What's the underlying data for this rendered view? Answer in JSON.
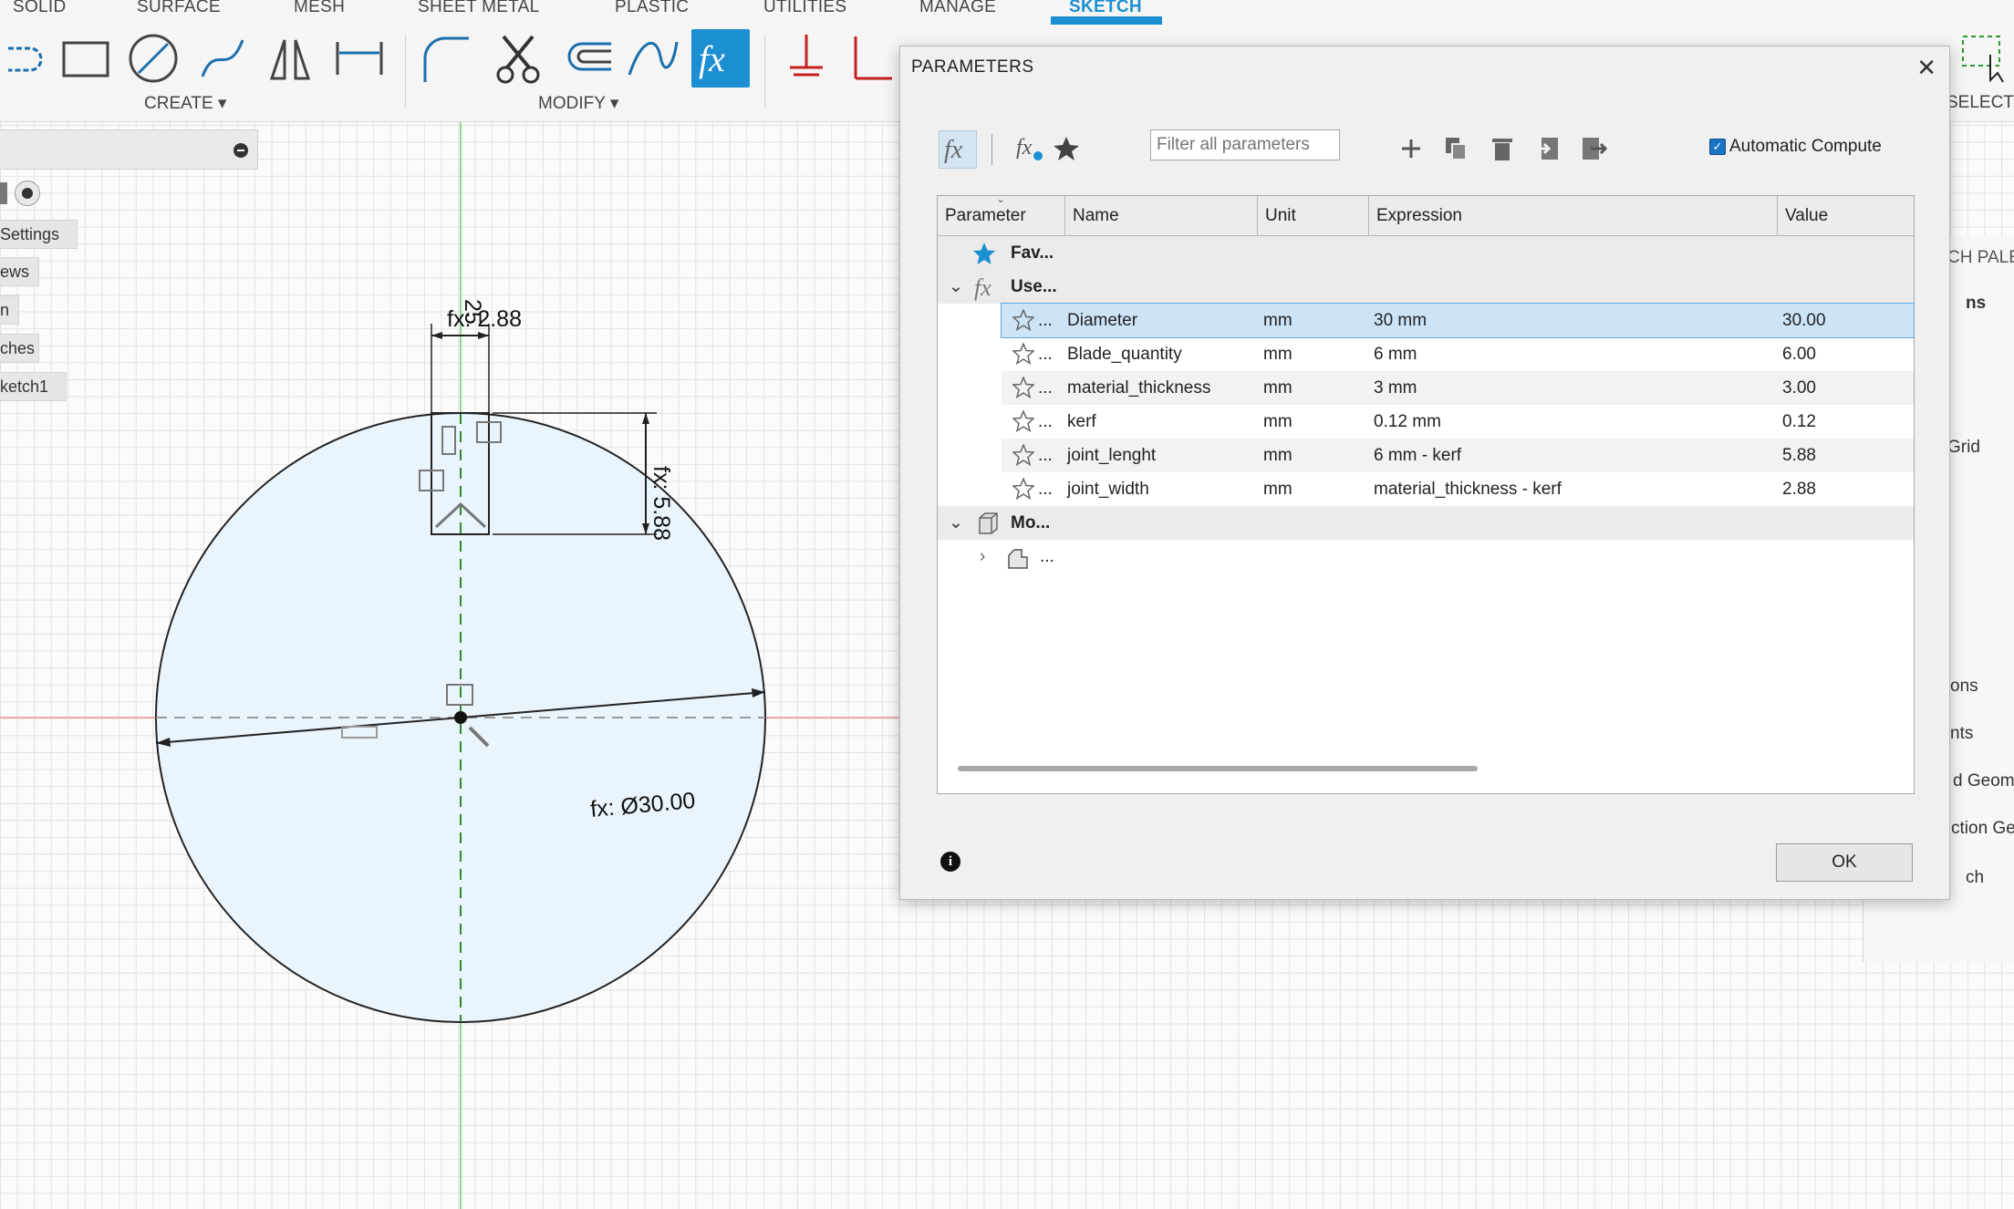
{
  "toolbar": {
    "tabs": [
      "SOLID",
      "SURFACE",
      "MESH",
      "SHEET METAL",
      "PLASTIC",
      "UTILITIES",
      "MANAGE",
      "SKETCH"
    ],
    "create_label": "CREATE ▾",
    "modify_label": "MODIFY ▾",
    "select_label": "SELECT",
    "accent_color": "#1b8fd2"
  },
  "browser": {
    "items": [
      "Settings",
      "ews",
      "n",
      "ches",
      "ketch1"
    ]
  },
  "canvas": {
    "dim_top_width": "fx: 2.88",
    "dim_height": "fx: 5.88",
    "dim_diameter": "fx: Ø30.00",
    "axis_label": "25"
  },
  "dialog": {
    "title": "PARAMETERS",
    "filter_placeholder": "Filter all parameters",
    "auto_compute_label": "Automatic Compute",
    "ok_label": "OK",
    "columns": [
      "Parameter",
      "Name",
      "Unit",
      "Expression",
      "Value"
    ],
    "groups": {
      "favorites": "Fav...",
      "user": "Use...",
      "model": "Mo...",
      "model_child": "..."
    },
    "rows": [
      {
        "dots": "...",
        "name": "Diameter",
        "unit": "mm",
        "expression": "30 mm",
        "value": "30.00"
      },
      {
        "dots": "...",
        "name": "Blade_quantity",
        "unit": "mm",
        "expression": "6 mm",
        "value": "6.00"
      },
      {
        "dots": "...",
        "name": "material_thickness",
        "unit": "mm",
        "expression": "3 mm",
        "value": "3.00"
      },
      {
        "dots": "...",
        "name": "kerf",
        "unit": "mm",
        "expression": "0.12 mm",
        "value": "0.12"
      },
      {
        "dots": "...",
        "name": "joint_lenght",
        "unit": "mm",
        "expression": "6 mm - kerf",
        "value": "5.88"
      },
      {
        "dots": "...",
        "name": "joint_width",
        "unit": "mm",
        "expression": "material_thickness - kerf",
        "value": "2.88"
      }
    ]
  },
  "right_panel": {
    "items": [
      "CH PALE",
      "ns",
      "Grid",
      "ons",
      "nts",
      "d Geome",
      "ction Geo",
      "ch"
    ]
  }
}
